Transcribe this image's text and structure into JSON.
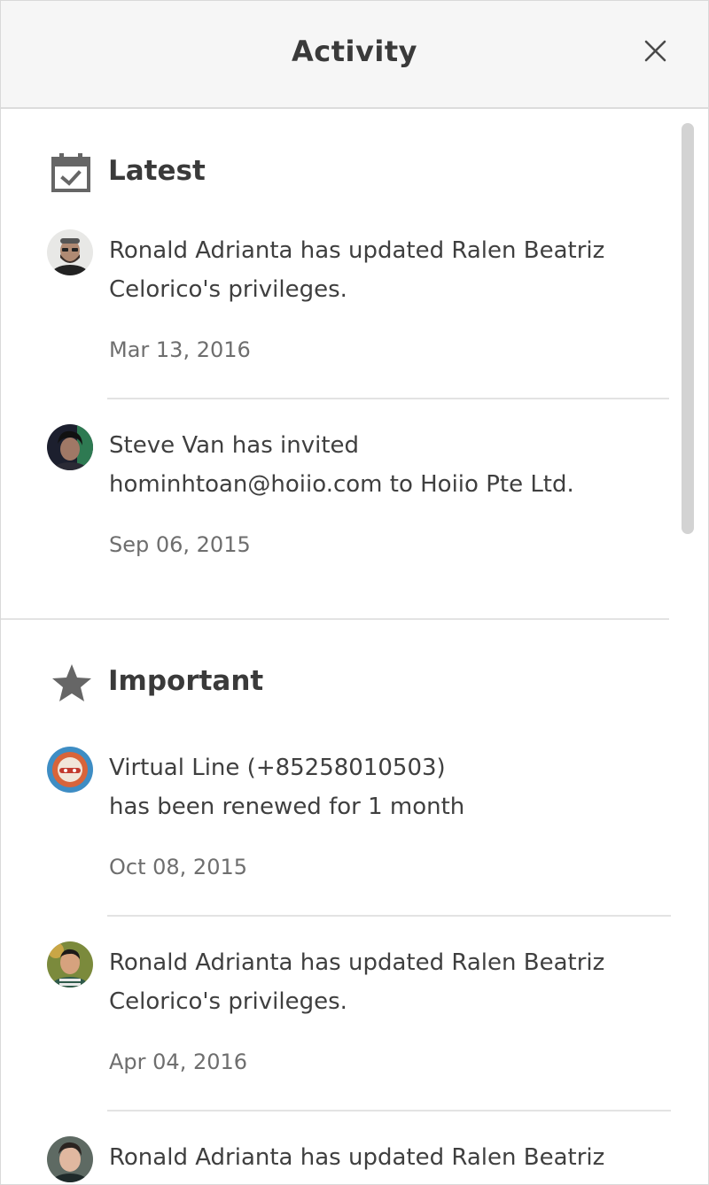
{
  "header": {
    "title": "Activity"
  },
  "sections": [
    {
      "title": "Latest",
      "icon": "calendar-check-icon",
      "items": [
        {
          "line1": "Ronald Adrianta has updated Ralen Beatriz",
          "line2": "Celorico's privileges.",
          "date": "Mar 13, 2016"
        },
        {
          "line1": "Steve Van has invited",
          "line2": "hominhtoan@hoiio.com to Hoiio Pte Ltd.",
          "date": "Sep 06, 2015"
        }
      ]
    },
    {
      "title": "Important",
      "icon": "star-icon",
      "items": [
        {
          "line1": "Virtual Line (+85258010503)",
          "line2": "has been renewed for 1 month",
          "date": "Oct 08, 2015"
        },
        {
          "line1": "Ronald Adrianta has updated Ralen Beatriz",
          "line2": "Celorico's privileges.",
          "date": "Apr 04, 2016"
        },
        {
          "line1": "Ronald Adrianta has updated Ralen Beatriz",
          "line2": "",
          "date": ""
        }
      ]
    }
  ],
  "colors": {
    "header_bg": "#f6f6f6",
    "text": "#3f3f3f",
    "muted": "#6e6e6e",
    "icon": "#666666",
    "divider": "#e3e3e3"
  }
}
